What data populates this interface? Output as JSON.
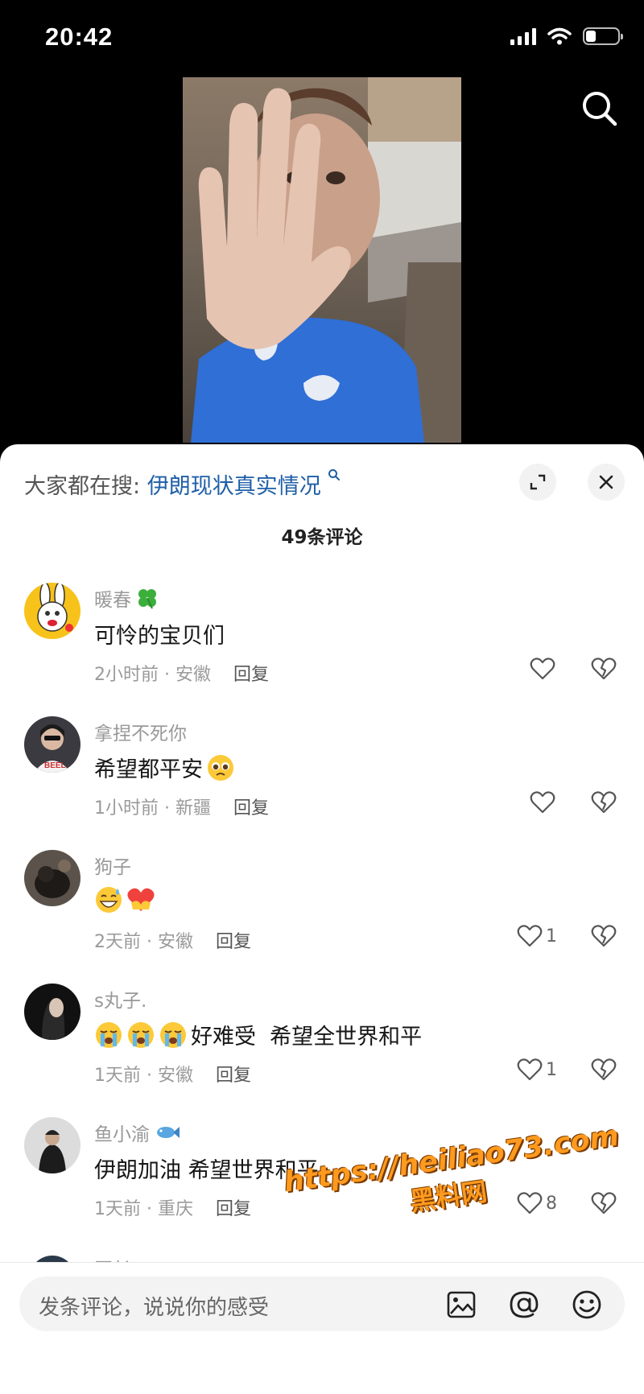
{
  "status": {
    "time": "20:42"
  },
  "sheet": {
    "trend_label": "大家都在搜:",
    "trend_query": "伊朗现状真实情况",
    "comment_count": "49条评论"
  },
  "comments": [
    {
      "name": "暖春",
      "name_emoji": "four-leaf-clover",
      "text": "可怜的宝贝们",
      "meta": "2小时前 · 安徽",
      "reply": "回复",
      "likes": ""
    },
    {
      "name": "拿捏不死你",
      "text": "希望都平安",
      "text_emoji": "pleading-face",
      "meta": "1小时前 · 新疆",
      "reply": "回复",
      "likes": ""
    },
    {
      "name": "狗子",
      "text": "",
      "text_emojis": [
        "grinning-sweat-face",
        "heart-hands"
      ],
      "meta": "2天前 · 安徽",
      "reply": "回复",
      "likes": "1"
    },
    {
      "name": "s丸子.",
      "text": "好难受  希望全世界和平",
      "text_emojis": [
        "crying-face",
        "crying-face",
        "crying-face"
      ],
      "meta": "1天前 · 安徽",
      "reply": "回复",
      "likes": "1"
    },
    {
      "name": "鱼小渝",
      "name_emoji": "fish",
      "text": "伊朗加油 希望世界和平",
      "meta": "1天前 · 重庆",
      "reply": "回复",
      "likes": "8"
    }
  ],
  "next_comment_name_partial": "匠长",
  "watermark": {
    "url": "https://heiliao73.com",
    "site": "黑料网"
  },
  "input": {
    "placeholder": "发条评论，说说你的感受"
  },
  "colors": {
    "link": "#1f5fa8",
    "watermark": "#ff9a1e"
  }
}
